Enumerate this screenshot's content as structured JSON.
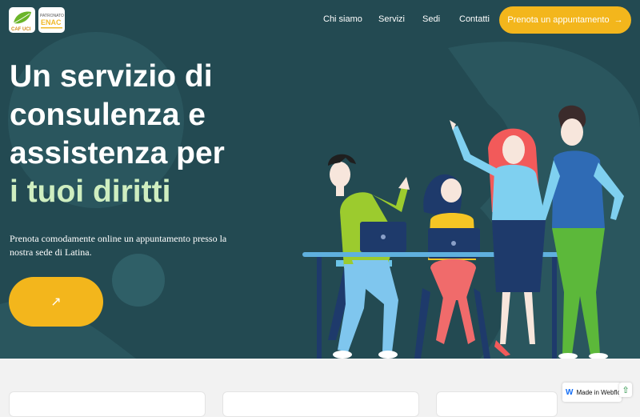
{
  "nav": {
    "logo_caf": "CAF UCI",
    "logo_enac_top": "PATRONATO",
    "logo_enac_bottom": "ENAC",
    "links": [
      "Chi siamo",
      "Servizi",
      "Sedi",
      "Contatti"
    ],
    "cta_label": "Prenota un appuntamento",
    "cta_arrow": "→"
  },
  "hero": {
    "title_lines": [
      "Un servizio di",
      "consulenza e",
      "assistenza per"
    ],
    "title_highlight": "i tuoi diritti",
    "subtitle": "Prenota comodamente online un appuntamento presso la nostra sede di Latina.",
    "round_button_icon": "↗"
  },
  "badges": {
    "webflow": "Made in Webflow",
    "scroll_top_icon": "⇧"
  },
  "colors": {
    "hero_bg": "#234a52",
    "accent": "#f3b61c",
    "highlight": "#cfeec0",
    "page_bg": "#f2f2f2"
  },
  "icons": [
    "caf-logo-icon",
    "enac-logo-icon",
    "arrow-right-icon",
    "arrow-up-right-icon",
    "webflow-icon",
    "scroll-top-icon"
  ]
}
